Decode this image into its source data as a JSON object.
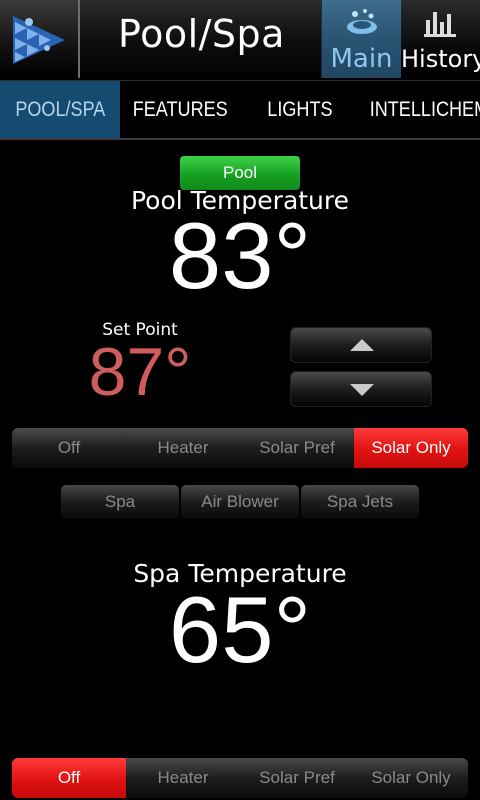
{
  "header": {
    "title": "Pool/Spa",
    "logo_icon": "pentair-logo-icon",
    "main_label": "Main",
    "main_icon": "pool-splash-icon",
    "history_label": "History",
    "history_icon": "bar-chart-icon"
  },
  "tabs": [
    {
      "label": "POOL/SPA",
      "active": true
    },
    {
      "label": "FEATURES",
      "active": false
    },
    {
      "label": "LIGHTS",
      "active": false
    },
    {
      "label": "INTELLICHEM",
      "active": false
    }
  ],
  "pool": {
    "body_label": "Pool",
    "temp_label": "Pool Temperature",
    "temperature": "83°",
    "setpoint_label": "Set Point",
    "setpoint_value": "87°",
    "modes": [
      "Off",
      "Heater",
      "Solar Pref",
      "Solar Only"
    ],
    "active_mode": "Solar Only"
  },
  "circuits": [
    "Spa",
    "Air Blower",
    "Spa Jets"
  ],
  "spa": {
    "temp_label": "Spa Temperature",
    "temperature": "65°",
    "modes": [
      "Off",
      "Heater",
      "Solar Pref",
      "Solar Only"
    ],
    "active_mode": "Off"
  },
  "colors": {
    "accent_blue": "#154b70",
    "active_green": "#18a023",
    "active_red": "#e01212",
    "setpoint_red": "#cf5d5d"
  }
}
